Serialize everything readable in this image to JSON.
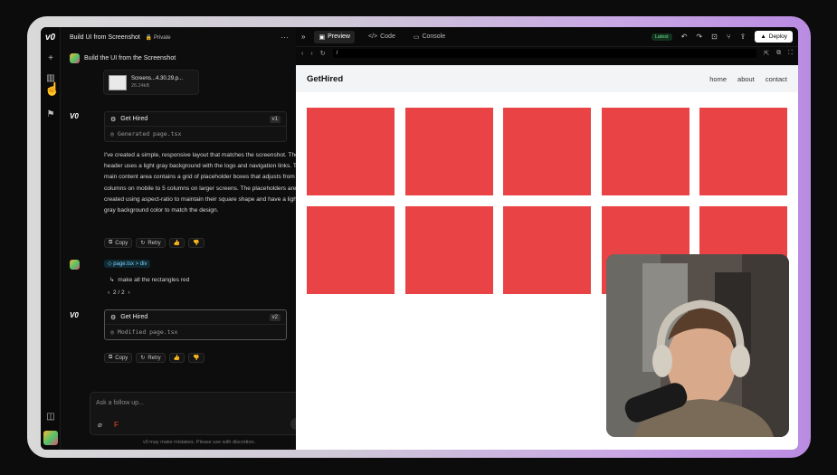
{
  "app": {
    "logo": "v0"
  },
  "chat": {
    "title": "Build UI from Screenshot",
    "privacy": "Private",
    "user_message_1": "Build the UI from the Screenshot",
    "attachment": {
      "name": "Screens...4.30.29.p...",
      "size": "26.24kB"
    },
    "response_1": {
      "card_title": "Get Hired",
      "version": "v1",
      "file_action": "Generated page.tsx",
      "paragraph": "I've created a simple, responsive layout that matches the screenshot. The header uses a light gray background with the logo and navigation links. The main content area contains a grid of placeholder boxes that adjusts from 2 columns on mobile to 5 columns on larger screens. The placeholders are created using aspect-ratio to maintain their square shape and have a light gray background color to match the design."
    },
    "actions": {
      "copy": "Copy",
      "retry": "Retry"
    },
    "user_message_2": {
      "tag": "page.tsx > div",
      "text": "make all the rectangles red",
      "pager": "2 / 2"
    },
    "response_2": {
      "card_title": "Get Hired",
      "version": "v2",
      "file_action": "Modified page.tsx"
    },
    "input": {
      "placeholder": "Ask a follow up..."
    },
    "disclaimer": "v0 may make mistakes. Please use with discretion."
  },
  "preview": {
    "tabs": [
      "Preview",
      "Code",
      "Console"
    ],
    "active_tab": "Preview",
    "badge": "Latest",
    "deploy_label": "Deploy",
    "url": "/"
  },
  "site": {
    "brand": "GetHired",
    "nav": [
      "home",
      "about",
      "contact"
    ],
    "box_color": "#ea4345",
    "box_count": 10
  }
}
